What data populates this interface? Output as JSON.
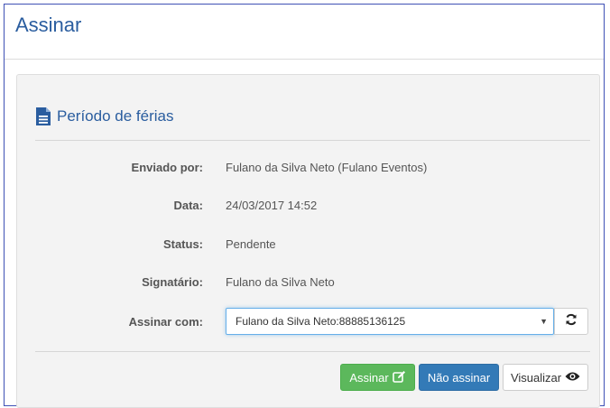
{
  "page": {
    "title": "Assinar"
  },
  "panel": {
    "title": "Período de férias",
    "icon": "document-icon"
  },
  "details": {
    "sent_by_label": "Enviado por:",
    "sent_by_value": "Fulano da Silva Neto (Fulano Eventos)",
    "date_label": "Data:",
    "date_value": "24/03/2017 14:52",
    "status_label": "Status:",
    "status_value": "Pendente",
    "signer_label": "Signatário:",
    "signer_value": "Fulano da Silva Neto",
    "sign_with_label": "Assinar com:",
    "sign_with_value": "Fulano da Silva Neto:88885136125"
  },
  "buttons": {
    "sign": "Assinar",
    "dont_sign": "Não assinar",
    "view": "Visualizar"
  },
  "colors": {
    "accent": "#2a5d9f",
    "success": "#5cb85c",
    "primary": "#337ab7"
  }
}
